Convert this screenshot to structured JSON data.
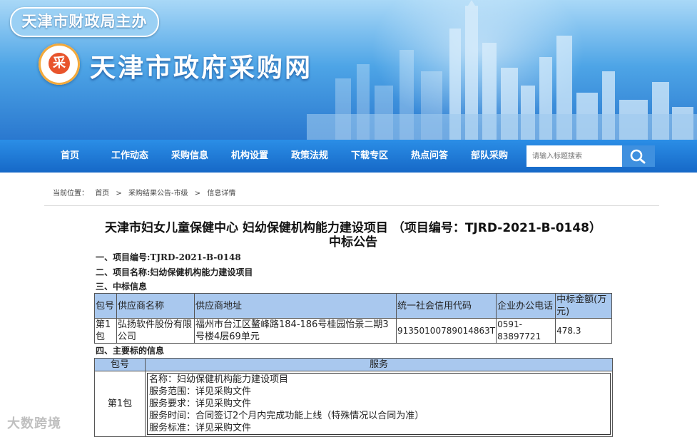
{
  "banner": {
    "sponsor": "天津市财政局主办",
    "logo_char": "采",
    "site_title": "天津市政府采购网"
  },
  "nav": {
    "items": [
      "首页",
      "工作动态",
      "采购信息",
      "机构设置",
      "政策法规",
      "下载专区",
      "热点问答",
      "部队采购"
    ],
    "search_placeholder": "请输入标题搜索",
    "search_icon": "magnifier-icon"
  },
  "breadcrumb": {
    "prefix": "当前位置：",
    "items": [
      "首页",
      "采购结果公告-市级",
      "信息详情"
    ],
    "separator": ">"
  },
  "article": {
    "title": "天津市妇女儿童保健中心 妇幼保健机构能力建设项目 （项目编号：TJRD-2021-B-0148）中标公告",
    "s1": "一、项目编号:TJRD-2021-B-0148",
    "s2": "二、项目名称:妇幼保健机构能力建设项目",
    "s3": "三、中标信息",
    "s4": "四、主要标的信息",
    "table1": {
      "headers": [
        "包号",
        "供应商名称",
        "供应商地址",
        "统一社会信用代码",
        "企业办公电话",
        "中标金额(万元)"
      ],
      "rows": [
        [
          "第1包",
          "弘扬软件股份有限公司",
          "福州市台江区鳌峰路184-186号桂园怡景二期3号楼4层69单元",
          "91350100789014863T",
          "0591-83897721",
          "478.3"
        ]
      ]
    },
    "table2": {
      "headers": [
        "包号",
        "服务"
      ],
      "package": "第1包",
      "service_lines": [
        "名称：妇幼保健机构能力建设项目",
        "服务范围：详见采购文件",
        "服务要求：详见采购文件",
        "服务时间：合同签订2个月内完成功能上线（特殊情况以合同为准）",
        "服务标准：详见采购文件"
      ]
    }
  },
  "watermark": "大数跨境",
  "colors": {
    "nav_bar": "#1b72cf",
    "table_header": "#a9c8ee",
    "search_button": "#3f90df"
  }
}
